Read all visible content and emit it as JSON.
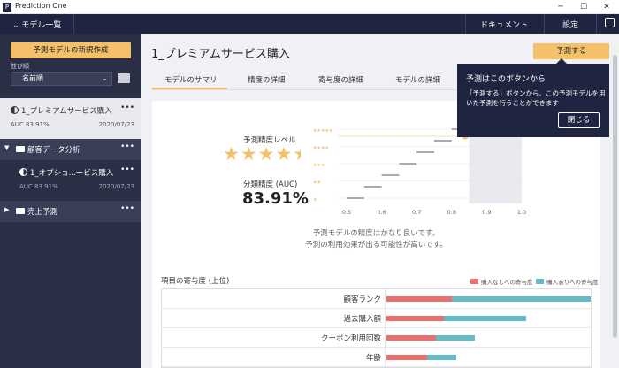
{
  "window": {
    "title": "Prediction One",
    "logo": "P"
  },
  "topbar": {
    "menu_label": "モデル一覧",
    "document": "ドキュメント",
    "settings": "設定"
  },
  "sidebar": {
    "new_button": "予測モデルの新規作成",
    "sort_label": "並び順",
    "sort_value": "名前順",
    "items": [
      {
        "name": "1_プレミアムサービス購入",
        "auc": "AUC  83.91%",
        "date": "2020/07/23"
      },
      {
        "name": "顧客データ分析"
      },
      {
        "name": "1_オプショ...ービス購入",
        "auc": "AUC  83.91%",
        "date": "2020/07/23"
      },
      {
        "name": "売上予測"
      }
    ]
  },
  "main": {
    "title": "1_プレミアムサービス購入",
    "predict_button": "予測する",
    "tabs": [
      "モデルのサマリ",
      "精度の詳細",
      "寄与度の詳細",
      "モデルの詳細"
    ],
    "summary": {
      "level_label": "予測精度レベル",
      "stars": 4.5,
      "auc_label": "分類精度 (AUC)",
      "auc_value": "83.91%",
      "note_line1": "予測モデルの精度はかなり良いです。",
      "note_line2": "予測の利用効果が出る可能性が高いです。"
    },
    "contribution": {
      "title": "項目の寄与度 (上位)",
      "legend_neg": "購入なしへの寄与度",
      "legend_pos": "購入ありへの寄与度",
      "rows": [
        {
          "label": "顧客ランク",
          "neg": 0.32,
          "pos": 0.68
        },
        {
          "label": "過去購入額",
          "neg": 0.28,
          "pos": 0.4
        },
        {
          "label": "クーポン利用回数",
          "neg": 0.24,
          "pos": 0.19
        },
        {
          "label": "年齢",
          "neg": 0.2,
          "pos": 0.14
        }
      ]
    }
  },
  "chart_data": {
    "type": "line",
    "x_ticks": [
      "0.5",
      "0.6",
      "0.7",
      "0.8",
      "0.9",
      "1.0"
    ],
    "xlim": [
      0.5,
      1.0
    ],
    "y_levels": [
      "★★★★★",
      "★★★★",
      "★★★",
      "★★",
      "★"
    ],
    "marker_x": 0.8391,
    "marker_level": 4.5,
    "steps_x": [
      0.5,
      0.55,
      0.6,
      0.65,
      0.7,
      0.75,
      0.8,
      0.85
    ]
  },
  "tooltip": {
    "title": "予測はこのボタンから",
    "body": "「予測する」ボタンから、この予測モデルを用いた予測を行うことができます",
    "close": "閉じる"
  },
  "colors": {
    "accent": "#f4c16a",
    "navy": "#1f2540",
    "neg": "#ee6e6e",
    "pos": "#63bcc7"
  }
}
